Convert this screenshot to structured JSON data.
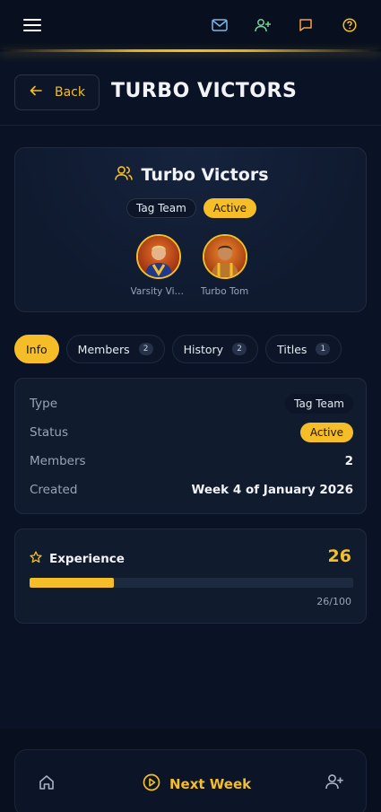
{
  "header": {
    "title": "TURBO VICTORS",
    "back_label": "Back"
  },
  "topbar": {
    "icons": [
      "menu-icon",
      "mail-icon",
      "add-user-icon",
      "chat-icon",
      "help-icon"
    ],
    "accent": "#f5be28"
  },
  "team": {
    "name": "Turbo Victors",
    "type_chip": "Tag Team",
    "status_chip": "Active",
    "members": [
      {
        "name": "Varsity Vic...",
        "avatar": "wrestler-avatar"
      },
      {
        "name": "Turbo Tom",
        "avatar": "wrestler-avatar"
      }
    ]
  },
  "tabs": [
    {
      "label": "Info",
      "count": null,
      "active": true
    },
    {
      "label": "Members",
      "count": "2",
      "active": false
    },
    {
      "label": "History",
      "count": "2",
      "active": false
    },
    {
      "label": "Titles",
      "count": "1",
      "active": false
    }
  ],
  "info": {
    "type_label": "Type",
    "type_value": "Tag Team",
    "status_label": "Status",
    "status_value": "Active",
    "members_label": "Members",
    "members_value": "2",
    "created_label": "Created",
    "created_value": "Week 4 of January 2026"
  },
  "experience": {
    "title": "Experience",
    "value": "26",
    "progress_fraction": 0.26,
    "caption": "26/100"
  },
  "bottom_nav": {
    "next_label": "Next Week",
    "icons": [
      "home-icon",
      "play-circle-icon",
      "add-user-icon"
    ]
  },
  "colors": {
    "background": "#0a1326",
    "accent": "#f5be28",
    "card": "#111b2e",
    "muted_text": "#9aa4b8"
  }
}
